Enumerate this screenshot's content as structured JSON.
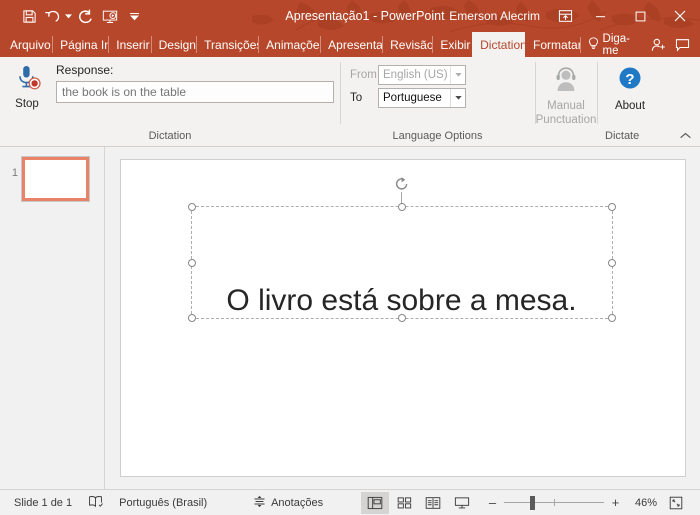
{
  "titlebar": {
    "quick_access": [
      {
        "name": "save-button",
        "icon": "save-icon"
      },
      {
        "name": "undo-button",
        "icon": "undo-icon"
      },
      {
        "name": "redo-button",
        "icon": "redo-icon"
      },
      {
        "name": "start-presentation-button",
        "icon": "presentation-icon"
      },
      {
        "name": "customize-quick-access-button",
        "icon": "chevron-down-icon"
      }
    ],
    "document_title": "Apresentação1",
    "separator": "-",
    "app_name": "PowerPoint",
    "account_name": "Emerson Alecrim",
    "ribbon_display_icon": "ribbon-display-options-icon",
    "minimize": "–",
    "maximize": "□",
    "close": "✕",
    "bg_color": "#b7472a"
  },
  "tabs": [
    {
      "label": "Arquivo",
      "active": false
    },
    {
      "label": "Página In",
      "active": false
    },
    {
      "label": "Inserir",
      "active": false
    },
    {
      "label": "Design",
      "active": false
    },
    {
      "label": "Transições",
      "active": false
    },
    {
      "label": "Animações",
      "active": false
    },
    {
      "label": "Apresentação",
      "active": false
    },
    {
      "label": "Revisão",
      "active": false
    },
    {
      "label": "Exibir",
      "active": false
    },
    {
      "label": "Dictation",
      "active": true
    },
    {
      "label": "Formatar",
      "active": false
    }
  ],
  "tab_right": {
    "tell_me_label": "Diga-me",
    "tell_me_icon": "lightbulb-icon",
    "share_icon": "share-person-icon",
    "comments_icon": "comment-icon"
  },
  "ribbon": {
    "dictation_group": {
      "label": "Dictation",
      "stop_button": {
        "label": "Stop",
        "icon": "microphone-recording-icon"
      },
      "response_label": "Response:",
      "response_value": "the book is on the table",
      "response_placeholder": "the book is on the table"
    },
    "language_group": {
      "label": "Language Options",
      "from_label": "From",
      "from_value": "English (US)",
      "from_disabled": true,
      "to_label": "To",
      "to_value": "Portuguese",
      "to_disabled": false
    },
    "dictate_group": {
      "label": "Dictate",
      "manual_punctuation": {
        "label_line1": "Manual",
        "label_line2": "Punctuation",
        "icon": "headset-person-icon",
        "disabled": true
      },
      "about": {
        "label": "About",
        "icon": "help-circle-icon"
      }
    },
    "collapse_icon": "chevron-up-icon"
  },
  "thumbnails": {
    "slides": [
      {
        "number": "1",
        "selected": true
      }
    ]
  },
  "slide": {
    "text": "O livro está sobre a mesa.",
    "rotate_icon": "rotate-handle-icon"
  },
  "statusbar": {
    "slide_count_label": "Slide 1 de 1",
    "accessibility_icon": "accessibility-book-icon",
    "language_label": "Português (Brasil)",
    "notes_label": "Anotações",
    "notes_icon": "notes-icon",
    "views": [
      {
        "name": "normal-view",
        "icon": "normal-view-icon",
        "active": true
      },
      {
        "name": "slide-sorter-view",
        "icon": "slide-sorter-icon",
        "active": false
      },
      {
        "name": "reading-view",
        "icon": "reading-view-icon",
        "active": false
      },
      {
        "name": "slide-show-view",
        "icon": "slide-show-icon",
        "active": false
      }
    ],
    "zoom_out": "–",
    "zoom_in": "+",
    "zoom_percent": "46%",
    "fit_icon": "fit-to-window-icon"
  }
}
